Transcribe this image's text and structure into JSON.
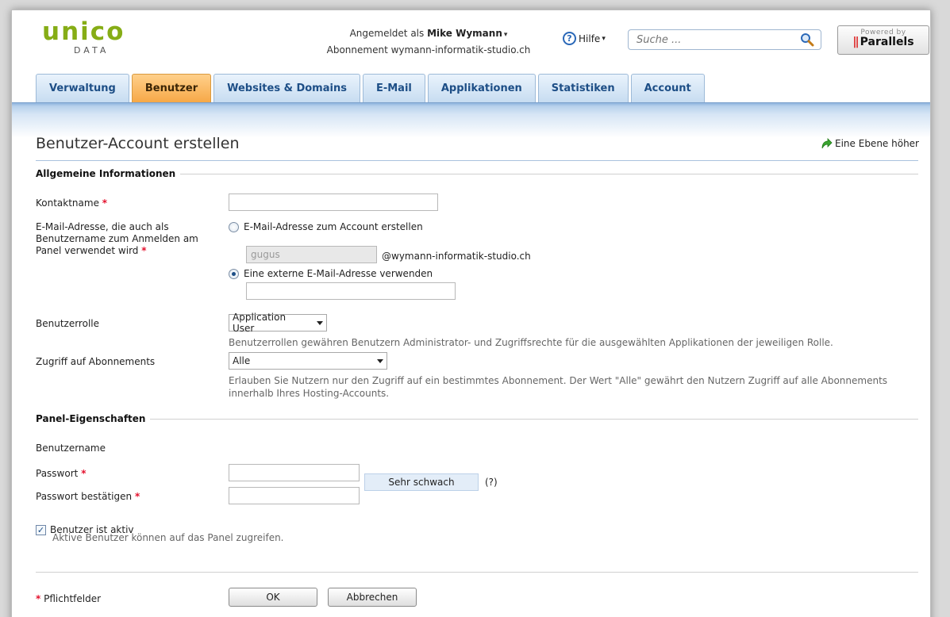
{
  "header": {
    "logo_main": "unico",
    "logo_sub": "DATA",
    "logged_in_prefix": "Angemeldet als",
    "user_name": "Mike Wymann",
    "subscription_text": "Abonnement wymann-informatik-studio.ch",
    "help_label": "Hilfe",
    "search_placeholder": "Suche ...",
    "powered_by": "Powered by",
    "brand": "Parallels"
  },
  "tabs": [
    {
      "label": "Verwaltung",
      "active": false
    },
    {
      "label": "Benutzer",
      "active": true
    },
    {
      "label": "Websites & Domains",
      "active": false
    },
    {
      "label": "E-Mail",
      "active": false
    },
    {
      "label": "Applikationen",
      "active": false
    },
    {
      "label": "Statistiken",
      "active": false
    },
    {
      "label": "Account",
      "active": false
    }
  ],
  "page": {
    "title": "Benutzer-Account erstellen",
    "up_link": "Eine Ebene höher"
  },
  "general": {
    "section_title": "Allgemeine Informationen",
    "contact_label": "Kontaktname",
    "contact_value": "",
    "email_label": "E-Mail-Adresse, die auch als Benutzername zum Anmelden am Panel verwendet wird",
    "radio_create_label": "E-Mail-Adresse zum Account erstellen",
    "mailbox_value": "gugus",
    "domain_suffix": "@wymann-informatik-studio.ch",
    "radio_external_label": "Eine externe E-Mail-Adresse verwenden",
    "external_value": "",
    "role_label": "Benutzerrolle",
    "role_value": "Application User",
    "role_hint": "Benutzerrollen gewähren Benutzern Administrator- und Zugriffsrechte für die ausgewählten Applikationen der jeweiligen Rolle.",
    "access_label": "Zugriff auf Abonnements",
    "access_value": "Alle",
    "access_hint": "Erlauben Sie Nutzern nur den Zugriff auf ein bestimmtes Abonnement. Der Wert \"Alle\" gewährt den Nutzern Zugriff auf alle Abonnements innerhalb Ihres Hosting-Accounts."
  },
  "panel": {
    "section_title": "Panel-Eigenschaften",
    "username_label": "Benutzername",
    "password_label": "Passwort",
    "password_strength": "Sehr schwach",
    "strength_help": "(?)",
    "confirm_label": "Passwort bestätigen",
    "active_label": "Benutzer ist aktiv",
    "active_checked": true,
    "active_hint": "Aktive Benutzer können auf das Panel zugreifen."
  },
  "footer": {
    "required_note": "Pflichtfelder",
    "ok_label": "OK",
    "cancel_label": "Abbrechen"
  },
  "colors": {
    "logo_green": "#86ad16",
    "active_tab": "#f6a847",
    "tab_blue": "#c7dcf1",
    "required_red": "#e4112d"
  }
}
